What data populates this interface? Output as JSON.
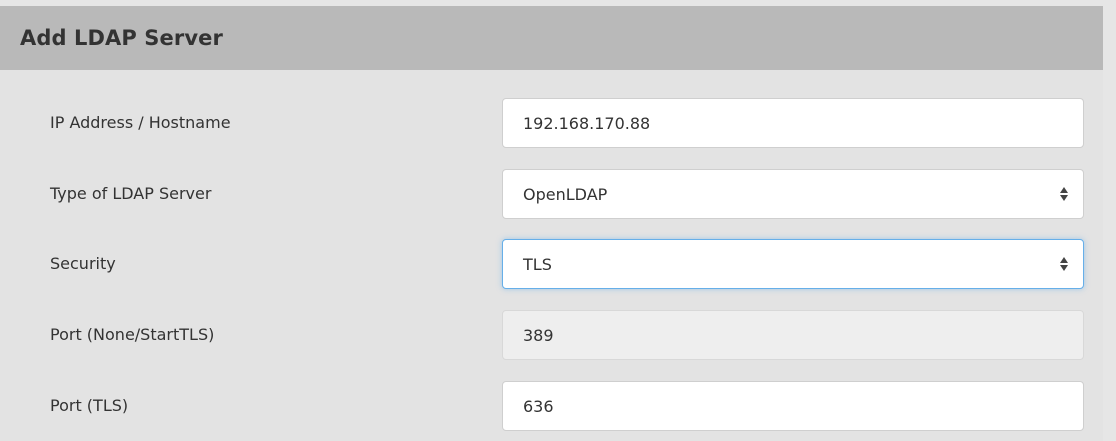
{
  "panel": {
    "title": "Add LDAP Server"
  },
  "form": {
    "ip_address": {
      "label": "IP Address / Hostname",
      "value": "192.168.170.88"
    },
    "server_type": {
      "label": "Type of LDAP Server",
      "value": "OpenLDAP"
    },
    "security": {
      "label": "Security",
      "value": "TLS"
    },
    "port_none_starttls": {
      "label": "Port (None/StartTLS)",
      "value": "389"
    },
    "port_tls": {
      "label": "Port (TLS)",
      "value": "636"
    }
  },
  "icons": {
    "select_arrows": "select-updown-icon"
  },
  "colors": {
    "header_background": "#b9b9b9",
    "body_background": "#e3e3e3",
    "focus_border": "#66afe9"
  }
}
